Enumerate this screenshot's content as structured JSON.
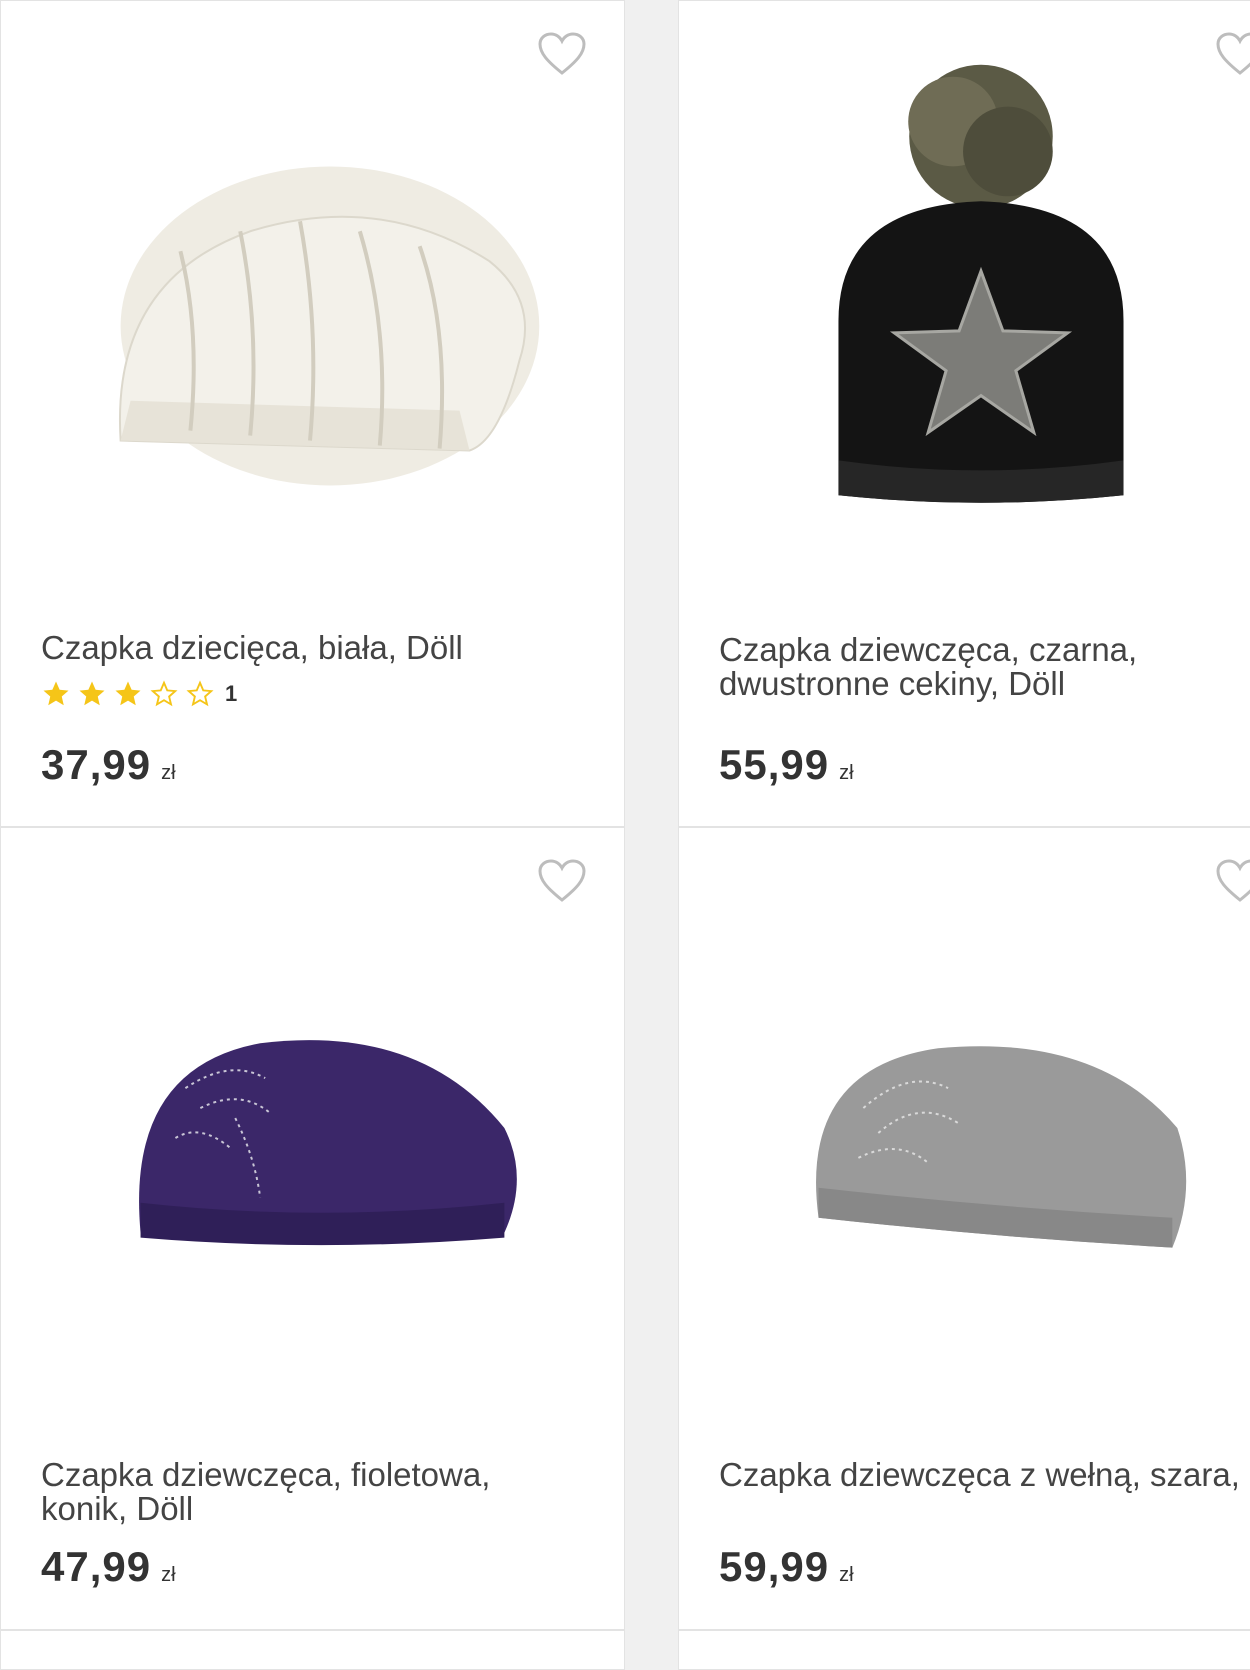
{
  "products": [
    {
      "name": "Czapka dziecięca, biała, Döll",
      "price": "37,99",
      "currency": "zł",
      "rating": {
        "stars": 3,
        "max": 5,
        "count": "1"
      },
      "hat_color": "#f3f1ea"
    },
    {
      "name": "Czapka dziewczęca, czarna,\ndwustronne cekiny, Döll",
      "price": "55,99",
      "currency": "zł",
      "hat_color": "#141414"
    },
    {
      "name": "Czapka dziewczęca, fioletowa,\nkonik, Döll",
      "price": "47,99",
      "currency": "zł",
      "hat_color": "#3b2769"
    },
    {
      "name": "Czapka dziewczęca z wełną, szara,\nDöll",
      "price": "59,99",
      "currency": "zł",
      "hat_color": "#9a9a9a"
    }
  ],
  "colors": {
    "star_filled": "#f5c518",
    "star_empty": "#f5c518",
    "heart_outline": "#bdbdbd"
  },
  "icons": {
    "wishlist": "heart-outline-icon",
    "rating": "star-icon"
  }
}
